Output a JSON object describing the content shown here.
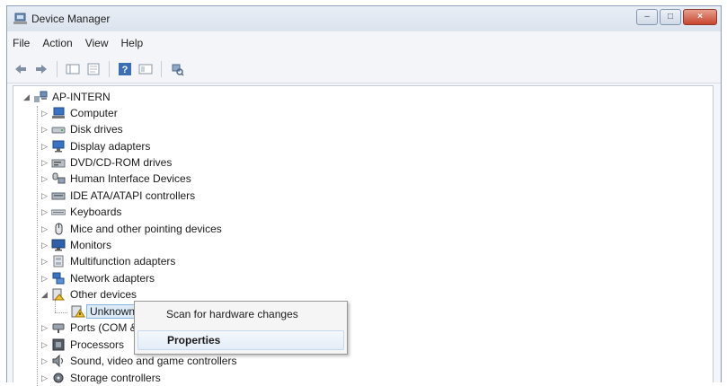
{
  "window": {
    "title": "Device Manager"
  },
  "menu": [
    "File",
    "Action",
    "View",
    "Help"
  ],
  "toolbar": {
    "buttons": [
      "back-icon",
      "forward-icon",
      "console-tree-icon",
      "export-icon",
      "help-icon",
      "show-hide-icon",
      "scan-hardware-icon"
    ]
  },
  "tree": {
    "root": "AP-INTERN",
    "categories": [
      "Computer",
      "Disk drives",
      "Display adapters",
      "DVD/CD-ROM drives",
      "Human Interface Devices",
      "IDE ATA/ATAPI controllers",
      "Keyboards",
      "Mice and other pointing devices",
      "Monitors",
      "Multifunction adapters",
      "Network adapters",
      "Other devices",
      "Unknown",
      "Ports (COM &",
      "Processors",
      "Sound, video and game controllers",
      "Storage controllers"
    ]
  },
  "context_menu": {
    "scan": "Scan for hardware changes",
    "properties": "Properties"
  }
}
